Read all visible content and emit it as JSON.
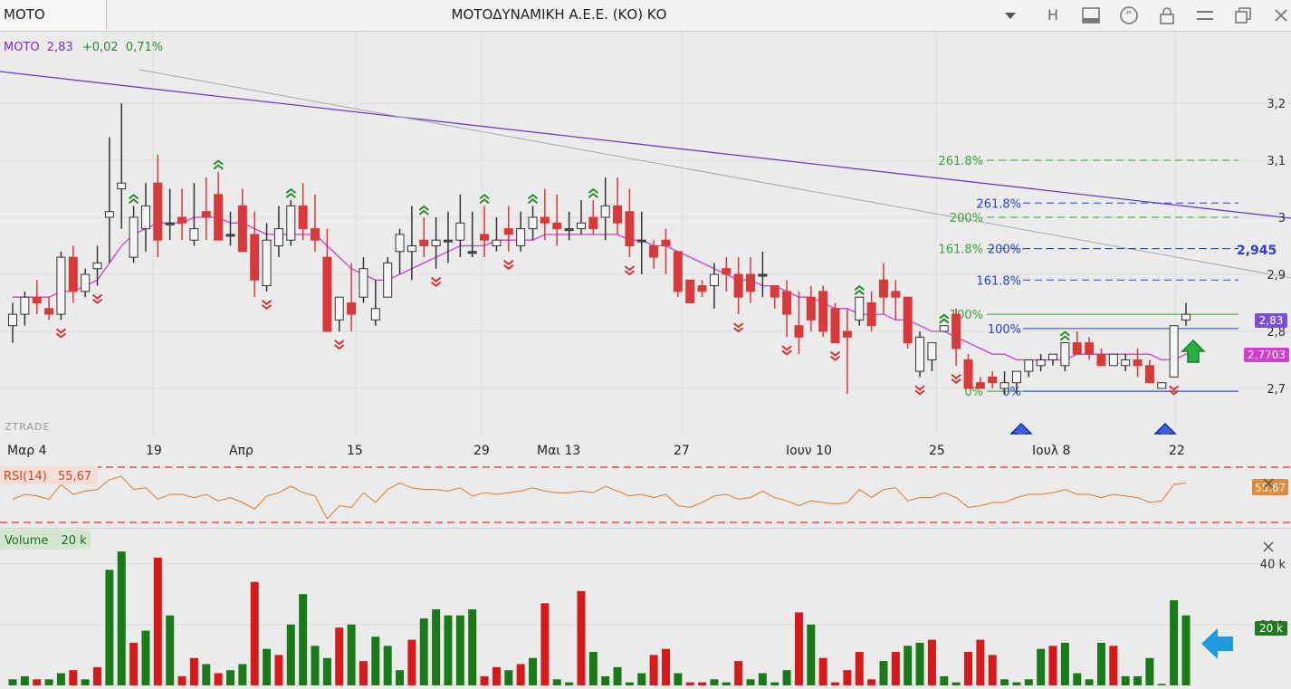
{
  "titlebar": {
    "symbol": "MOTO",
    "company": "ΜΟΤΟΔΥΝΑΜΙΚΗ Α.Ε.Ε. (ΚΟ) ΚΟ",
    "h_button": "H"
  },
  "price_panel": {
    "symbol": "MOTO",
    "last": "2,83",
    "change": "+0,02",
    "change_pct": "0,71%",
    "watermark": "ZTRADE",
    "last_badge": "2,83",
    "ma_badge": "2,7703",
    "target_label": "2,945",
    "y_ticks": [
      {
        "label": "3,2",
        "value": 3.2
      },
      {
        "label": "3,1",
        "value": 3.1
      },
      {
        "label": "3",
        "value": 3.0
      },
      {
        "label": "2,9",
        "value": 2.9
      },
      {
        "label": "2,8",
        "value": 2.8
      },
      {
        "label": "2,7",
        "value": 2.7
      }
    ],
    "fib_green": [
      {
        "label": "261.8%",
        "value": 3.1
      },
      {
        "label": "200%",
        "value": 3.0
      },
      {
        "label": "161.8%",
        "value": 2.945
      },
      {
        "label": "100%",
        "value": 2.83
      },
      {
        "label": "0%",
        "value": 2.695
      }
    ],
    "fib_blue": [
      {
        "label": "261.8%",
        "value": 3.025
      },
      {
        "label": "200%",
        "value": 2.945
      },
      {
        "label": "161.8%",
        "value": 2.89
      },
      {
        "label": "100%",
        "value": 2.805
      },
      {
        "label": "0%",
        "value": 2.695
      }
    ],
    "colors": {
      "up": "#f4f4f4",
      "down": "#d63a3a",
      "neutral": "#555555",
      "ma": "#d23cd2",
      "trend": "#6a3ec8",
      "green_fib": "#3aa03a",
      "blue_fib": "#2a3fd0"
    }
  },
  "x_axis": [
    "Μαρ 4",
    "19",
    "Απρ",
    "15",
    "29",
    "Μαι 13",
    "27",
    "Ιουν 10",
    "25",
    "Ιουλ 8",
    "22"
  ],
  "rsi_panel": {
    "label": "RSI(14)",
    "value": "55,67",
    "badge": "55,67"
  },
  "volume_panel": {
    "label": "Volume",
    "value": "20 k",
    "ticks": [
      {
        "label": "40 k",
        "value": 40
      },
      {
        "label": "20 k",
        "value": 20
      }
    ],
    "badge": "20 k"
  },
  "chart_data": {
    "type": "candlestick",
    "y_range": [
      2.65,
      3.27
    ],
    "candles": [
      [
        2.81,
        2.85,
        2.78,
        2.83
      ],
      [
        2.83,
        2.87,
        2.81,
        2.86
      ],
      [
        2.86,
        2.89,
        2.83,
        2.85
      ],
      [
        2.84,
        2.86,
        2.82,
        2.83
      ],
      [
        2.83,
        2.94,
        2.82,
        2.93
      ],
      [
        2.93,
        2.95,
        2.85,
        2.87
      ],
      [
        2.87,
        2.91,
        2.86,
        2.9
      ],
      [
        2.91,
        2.95,
        2.88,
        2.92
      ],
      [
        3.0,
        3.14,
        2.92,
        3.01
      ],
      [
        3.05,
        3.2,
        2.98,
        3.06
      ],
      [
        2.93,
        3.02,
        2.92,
        3.0
      ],
      [
        2.98,
        3.06,
        2.94,
        3.02
      ],
      [
        3.06,
        3.11,
        2.93,
        2.96
      ],
      [
        2.99,
        3.05,
        2.96,
        2.99
      ],
      [
        3.0,
        3.05,
        2.96,
        2.99
      ],
      [
        2.96,
        3.06,
        2.95,
        2.98
      ],
      [
        3.01,
        3.07,
        2.96,
        3.0
      ],
      [
        3.04,
        3.08,
        2.96,
        2.96
      ],
      [
        2.97,
        3.01,
        2.95,
        2.97
      ],
      [
        3.02,
        3.05,
        2.94,
        2.94
      ],
      [
        2.97,
        3.01,
        2.86,
        2.89
      ],
      [
        2.88,
        2.99,
        2.87,
        2.96
      ],
      [
        2.95,
        3.02,
        2.93,
        2.98
      ],
      [
        2.96,
        3.03,
        2.95,
        3.02
      ],
      [
        3.02,
        3.06,
        2.96,
        2.98
      ],
      [
        2.98,
        3.04,
        2.94,
        2.96
      ],
      [
        2.93,
        2.98,
        2.81,
        2.8
      ],
      [
        2.82,
        2.86,
        2.8,
        2.86
      ],
      [
        2.85,
        2.92,
        2.8,
        2.83
      ],
      [
        2.86,
        2.93,
        2.85,
        2.91
      ],
      [
        2.82,
        2.89,
        2.81,
        2.84
      ],
      [
        2.86,
        2.93,
        2.86,
        2.92
      ],
      [
        2.94,
        2.98,
        2.9,
        2.97
      ],
      [
        2.94,
        3.02,
        2.89,
        2.95
      ],
      [
        2.96,
        3.0,
        2.93,
        2.95
      ],
      [
        2.95,
        3.0,
        2.91,
        2.96
      ],
      [
        2.96,
        3.01,
        2.92,
        2.96
      ],
      [
        2.96,
        3.04,
        2.93,
        2.99
      ],
      [
        2.94,
        3.01,
        2.93,
        2.94
      ],
      [
        2.97,
        3.02,
        2.93,
        2.96
      ],
      [
        2.95,
        3.0,
        2.94,
        2.96
      ],
      [
        2.98,
        3.02,
        2.94,
        2.97
      ],
      [
        2.95,
        3.01,
        2.94,
        2.98
      ],
      [
        2.98,
        3.02,
        2.96,
        3.0
      ],
      [
        3.0,
        3.05,
        2.96,
        2.99
      ],
      [
        2.99,
        3.04,
        2.95,
        2.98
      ],
      [
        2.98,
        3.01,
        2.96,
        2.98
      ],
      [
        2.98,
        3.03,
        2.97,
        2.99
      ],
      [
        3.0,
        3.03,
        2.97,
        2.98
      ],
      [
        3.0,
        3.07,
        2.96,
        3.02
      ],
      [
        3.02,
        3.07,
        2.97,
        2.99
      ],
      [
        3.01,
        3.05,
        2.93,
        2.95
      ],
      [
        2.96,
        3.01,
        2.9,
        2.96
      ],
      [
        2.95,
        2.96,
        2.91,
        2.93
      ],
      [
        2.96,
        2.98,
        2.9,
        2.95
      ],
      [
        2.94,
        2.94,
        2.86,
        2.87
      ],
      [
        2.89,
        2.89,
        2.85,
        2.85
      ],
      [
        2.88,
        2.89,
        2.86,
        2.87
      ],
      [
        2.88,
        2.92,
        2.84,
        2.9
      ],
      [
        2.91,
        2.93,
        2.87,
        2.9
      ],
      [
        2.9,
        2.93,
        2.83,
        2.86
      ],
      [
        2.9,
        2.93,
        2.85,
        2.87
      ],
      [
        2.9,
        2.94,
        2.86,
        2.9
      ],
      [
        2.88,
        2.88,
        2.84,
        2.86
      ],
      [
        2.87,
        2.89,
        2.79,
        2.83
      ],
      [
        2.81,
        2.87,
        2.76,
        2.79
      ],
      [
        2.86,
        2.88,
        2.8,
        2.82
      ],
      [
        2.87,
        2.88,
        2.79,
        2.8
      ],
      [
        2.84,
        2.85,
        2.78,
        2.78
      ],
      [
        2.8,
        2.84,
        2.69,
        2.79
      ],
      [
        2.82,
        2.86,
        2.81,
        2.86
      ],
      [
        2.85,
        2.87,
        2.8,
        2.81
      ],
      [
        2.89,
        2.92,
        2.83,
        2.86
      ],
      [
        2.87,
        2.89,
        2.82,
        2.86
      ],
      [
        2.86,
        2.86,
        2.77,
        2.78
      ],
      [
        2.73,
        2.8,
        2.72,
        2.79
      ],
      [
        2.75,
        2.78,
        2.73,
        2.78
      ],
      [
        2.8,
        2.81,
        2.8,
        2.81
      ],
      [
        2.83,
        2.84,
        2.74,
        2.77
      ],
      [
        2.75,
        2.76,
        2.7,
        2.7
      ],
      [
        2.71,
        2.72,
        2.7,
        2.7
      ],
      [
        2.72,
        2.73,
        2.7,
        2.71
      ],
      [
        2.7,
        2.73,
        2.69,
        2.71
      ],
      [
        2.71,
        2.73,
        2.69,
        2.73
      ],
      [
        2.73,
        2.75,
        2.72,
        2.75
      ],
      [
        2.74,
        2.76,
        2.73,
        2.75
      ],
      [
        2.75,
        2.76,
        2.74,
        2.76
      ],
      [
        2.74,
        2.78,
        2.73,
        2.78
      ],
      [
        2.78,
        2.8,
        2.76,
        2.76
      ],
      [
        2.78,
        2.79,
        2.75,
        2.76
      ],
      [
        2.76,
        2.77,
        2.74,
        2.74
      ],
      [
        2.74,
        2.76,
        2.74,
        2.76
      ],
      [
        2.74,
        2.76,
        2.73,
        2.75
      ],
      [
        2.75,
        2.77,
        2.72,
        2.74
      ],
      [
        2.74,
        2.75,
        2.72,
        2.71
      ],
      [
        2.7,
        2.71,
        2.7,
        2.71
      ],
      [
        2.72,
        2.81,
        2.72,
        2.81
      ],
      [
        2.82,
        2.85,
        2.81,
        2.83
      ]
    ],
    "ma": [
      2.86,
      2.86,
      2.86,
      2.86,
      2.87,
      2.87,
      2.88,
      2.89,
      2.92,
      2.95,
      2.97,
      2.98,
      2.99,
      2.99,
      2.99,
      3.0,
      3.0,
      3.0,
      2.99,
      2.99,
      2.98,
      2.97,
      2.97,
      2.97,
      2.97,
      2.97,
      2.95,
      2.93,
      2.91,
      2.9,
      2.89,
      2.89,
      2.9,
      2.91,
      2.92,
      2.93,
      2.94,
      2.95,
      2.95,
      2.95,
      2.96,
      2.96,
      2.96,
      2.96,
      2.97,
      2.97,
      2.97,
      2.97,
      2.97,
      2.97,
      2.97,
      2.96,
      2.96,
      2.95,
      2.95,
      2.94,
      2.93,
      2.92,
      2.91,
      2.9,
      2.89,
      2.89,
      2.88,
      2.88,
      2.87,
      2.86,
      2.86,
      2.85,
      2.84,
      2.84,
      2.83,
      2.83,
      2.83,
      2.82,
      2.82,
      2.81,
      2.8,
      2.8,
      2.79,
      2.78,
      2.77,
      2.76,
      2.76,
      2.75,
      2.75,
      2.75,
      2.75,
      2.75,
      2.76,
      2.76,
      2.76,
      2.76,
      2.76,
      2.76,
      2.76,
      2.75,
      2.75,
      2.76,
      2.77
    ],
    "volume": [
      [
        2,
        "g"
      ],
      [
        3,
        "g"
      ],
      [
        2,
        "r"
      ],
      [
        2,
        "g"
      ],
      [
        4,
        "g"
      ],
      [
        5,
        "r"
      ],
      [
        2,
        "g"
      ],
      [
        6,
        "r"
      ],
      [
        38,
        "g"
      ],
      [
        44,
        "g"
      ],
      [
        14,
        "r"
      ],
      [
        18,
        "g"
      ],
      [
        42,
        "r"
      ],
      [
        23,
        "g"
      ],
      [
        3,
        "r"
      ],
      [
        9,
        "r"
      ],
      [
        7,
        "g"
      ],
      [
        4,
        "r"
      ],
      [
        5,
        "g"
      ],
      [
        7,
        "g"
      ],
      [
        34,
        "r"
      ],
      [
        12,
        "g"
      ],
      [
        10,
        "r"
      ],
      [
        20,
        "g"
      ],
      [
        30,
        "g"
      ],
      [
        13,
        "g"
      ],
      [
        9,
        "g"
      ],
      [
        19,
        "r"
      ],
      [
        20,
        "g"
      ],
      [
        8,
        "r"
      ],
      [
        16,
        "g"
      ],
      [
        13,
        "g"
      ],
      [
        5,
        "g"
      ],
      [
        15,
        "r"
      ],
      [
        22,
        "g"
      ],
      [
        25,
        "g"
      ],
      [
        23,
        "g"
      ],
      [
        23,
        "g"
      ],
      [
        25,
        "g"
      ],
      [
        3,
        "r"
      ],
      [
        6,
        "r"
      ],
      [
        5,
        "g"
      ],
      [
        7,
        "r"
      ],
      [
        9,
        "g"
      ],
      [
        27,
        "r"
      ],
      [
        2,
        "g"
      ],
      [
        1,
        "g"
      ],
      [
        31,
        "r"
      ],
      [
        11,
        "g"
      ],
      [
        3,
        "g"
      ],
      [
        6,
        "g"
      ],
      [
        1,
        "g"
      ],
      [
        4,
        "g"
      ],
      [
        10,
        "r"
      ],
      [
        12,
        "r"
      ],
      [
        4,
        "g"
      ],
      [
        1,
        "r"
      ],
      [
        1,
        "r"
      ],
      [
        2,
        "g"
      ],
      [
        1,
        "g"
      ],
      [
        8,
        "r"
      ],
      [
        2,
        "g"
      ],
      [
        4,
        "g"
      ],
      [
        1,
        "g"
      ],
      [
        5,
        "g"
      ],
      [
        24,
        "r"
      ],
      [
        20,
        "g"
      ],
      [
        9,
        "r"
      ],
      [
        1,
        "r"
      ],
      [
        5,
        "r"
      ],
      [
        11,
        "r"
      ],
      [
        2,
        "r"
      ],
      [
        8,
        "g"
      ],
      [
        11,
        "r"
      ],
      [
        13,
        "g"
      ],
      [
        14,
        "g"
      ],
      [
        15,
        "r"
      ],
      [
        3,
        "g"
      ],
      [
        1,
        "g"
      ],
      [
        11,
        "r"
      ],
      [
        15,
        "r"
      ],
      [
        10,
        "r"
      ],
      [
        2,
        "g"
      ],
      [
        1,
        "g"
      ],
      [
        2,
        "g"
      ],
      [
        12,
        "g"
      ],
      [
        13,
        "r"
      ],
      [
        14,
        "g"
      ],
      [
        4,
        "g"
      ],
      [
        2,
        "g"
      ],
      [
        14,
        "g"
      ],
      [
        13,
        "r"
      ],
      [
        3,
        "g"
      ],
      [
        3,
        "g"
      ],
      [
        9,
        "g"
      ],
      [
        0.5,
        "g"
      ],
      [
        28,
        "g"
      ],
      [
        23,
        "g"
      ]
    ]
  }
}
